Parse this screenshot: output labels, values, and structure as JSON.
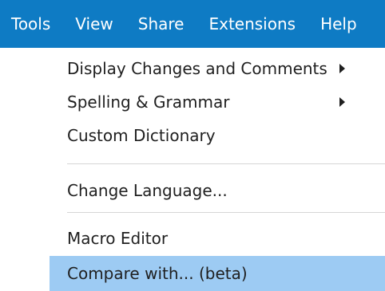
{
  "menubar": {
    "items": [
      {
        "label": "Tools"
      },
      {
        "label": "View"
      },
      {
        "label": "Share"
      },
      {
        "label": "Extensions"
      },
      {
        "label": "Help"
      }
    ]
  },
  "tools_menu": {
    "items": [
      {
        "label": "Display Changes and Comments",
        "has_submenu": true
      },
      {
        "label": "Spelling & Grammar",
        "has_submenu": true
      },
      {
        "label": "Custom Dictionary"
      },
      {
        "label": "Change Language..."
      },
      {
        "label": "Macro Editor"
      },
      {
        "label": "Compare with... (beta)",
        "highlighted": true
      }
    ]
  },
  "colors": {
    "menubar_bg": "#0e7bc4",
    "highlight_bg": "#9dcbf3"
  }
}
